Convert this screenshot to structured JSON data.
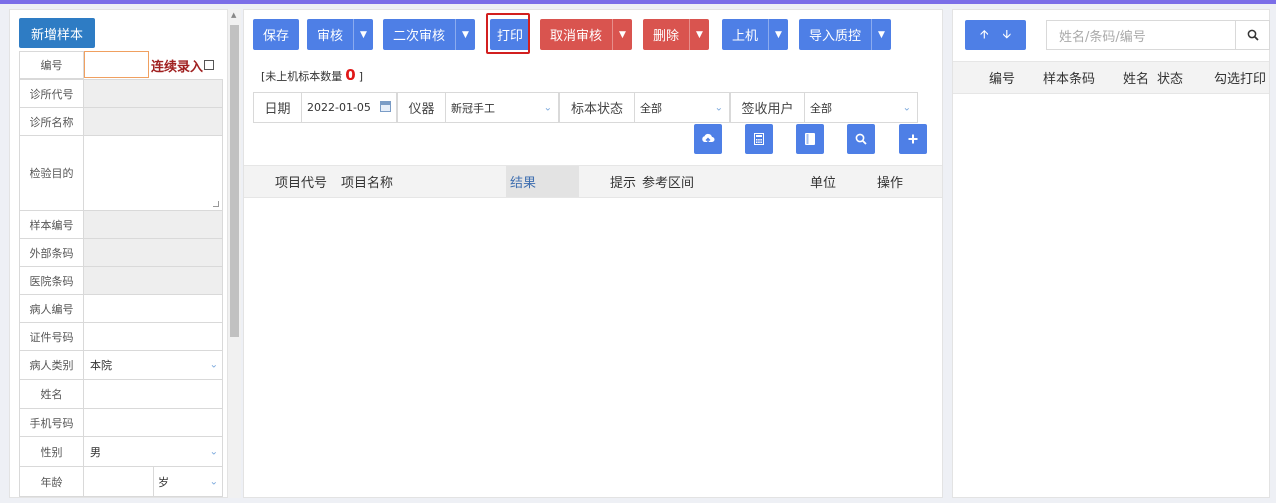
{
  "left": {
    "new_sample_label": "新增样本",
    "code_label": "编号",
    "continuous_label": "连续录入",
    "fields": [
      {
        "label": "诊所代号",
        "value": ""
      },
      {
        "label": "诊所名称",
        "value": ""
      },
      {
        "label": "检验目的",
        "value": ""
      },
      {
        "label": "样本编号",
        "value": ""
      },
      {
        "label": "外部条码",
        "value": ""
      },
      {
        "label": "医院条码",
        "value": ""
      },
      {
        "label": "病人编号",
        "value": ""
      },
      {
        "label": "证件号码",
        "value": ""
      },
      {
        "label": "病人类别",
        "value": "本院"
      },
      {
        "label": "姓名",
        "value": ""
      },
      {
        "label": "手机号码",
        "value": ""
      },
      {
        "label": "性别",
        "value": "男"
      },
      {
        "label": "年龄",
        "value": "",
        "unit": "岁"
      }
    ]
  },
  "toolbar": {
    "save": "保存",
    "audit": "审核",
    "second_audit": "二次审核",
    "print": "打印",
    "cancel_audit": "取消审核",
    "delete": "删除",
    "load": "上机",
    "import_qc": "导入质控"
  },
  "pending": {
    "prefix": "[未上机标本数量",
    "count": "0",
    "suffix": "]"
  },
  "filters": {
    "date_label": "日期",
    "date_value": "2022-01-05",
    "instrument_label": "仪器",
    "instrument_value": "新冠手工",
    "status_label": "标本状态",
    "status_value": "全部",
    "receiver_label": "签收用户",
    "receiver_value": "全部"
  },
  "icon_buttons": [
    "cloud-upload-icon",
    "calculator-icon",
    "square-icon",
    "search-icon",
    "plus-icon"
  ],
  "result_table": {
    "columns": [
      "项目代号",
      "项目名称",
      "结果",
      "提示",
      "参考区间",
      "单位",
      "操作"
    ]
  },
  "right": {
    "search_placeholder": "姓名/条码/编号",
    "columns": [
      "编号",
      "样本条码",
      "姓名",
      "状态",
      "勾选打印"
    ]
  },
  "colors": {
    "accent_blue": "#4e7fe6",
    "danger_red": "#d9544f",
    "top_bar": "#7b6ee8"
  }
}
